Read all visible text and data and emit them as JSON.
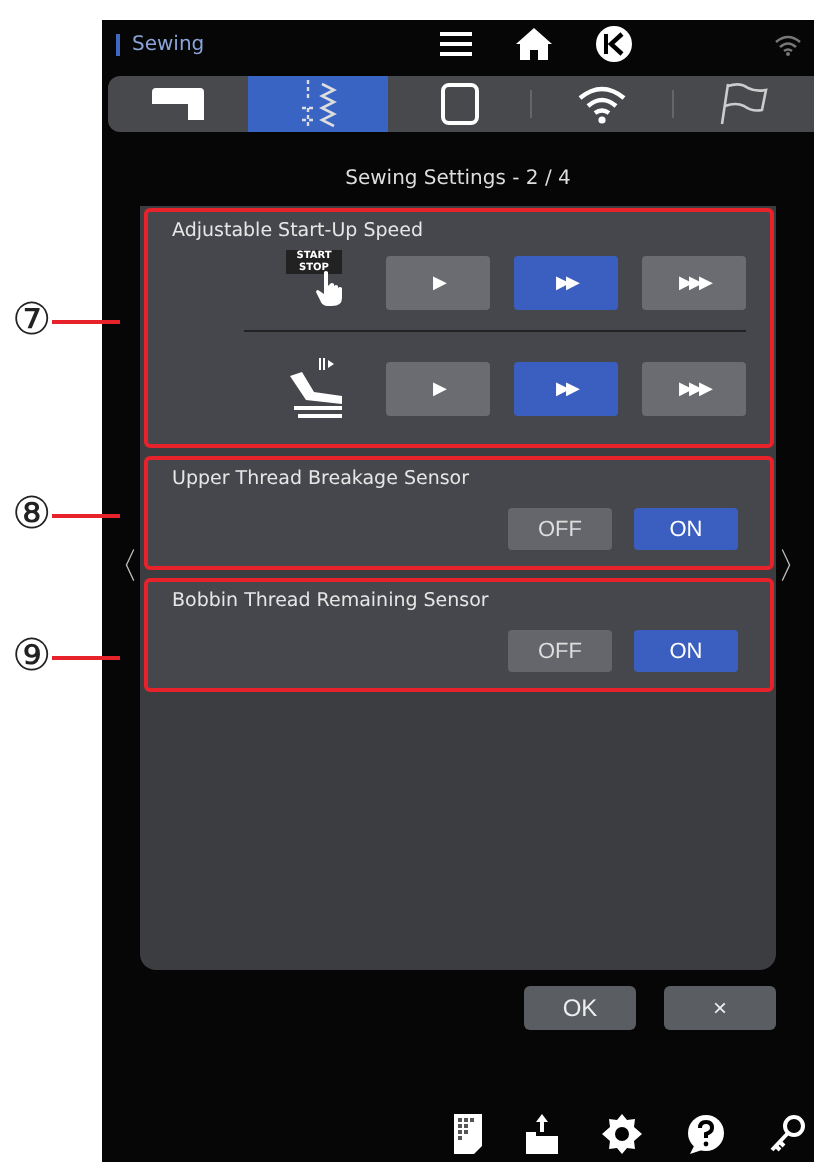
{
  "header": {
    "title": "Sewing"
  },
  "tabs": [
    {
      "kind": "machine",
      "selected": false
    },
    {
      "kind": "stitch",
      "selected": true
    },
    {
      "kind": "hoop",
      "selected": false
    },
    {
      "kind": "wifi",
      "selected": false
    },
    {
      "kind": "flag",
      "selected": false
    }
  ],
  "page_title": "Sewing Settings  -  2 / 4",
  "sections": [
    {
      "callout": "⑦",
      "title": "Adjustable Start-Up Speed",
      "kind": "speed",
      "rows": [
        {
          "kind": "start-stop",
          "icon_text": [
            "START",
            "STOP"
          ],
          "options": [
            {
              "label": "▶",
              "selected": false
            },
            {
              "label": "▶▶",
              "selected": true
            },
            {
              "label": "▶▶▶",
              "selected": false
            }
          ]
        },
        {
          "kind": "pedal",
          "options": [
            {
              "label": "▶",
              "selected": false
            },
            {
              "label": "▶▶",
              "selected": true
            },
            {
              "label": "▶▶▶",
              "selected": false
            }
          ]
        }
      ]
    },
    {
      "callout": "⑧",
      "title": "Upper Thread Breakage Sensor",
      "kind": "toggle",
      "options": [
        {
          "label": "OFF",
          "selected": false
        },
        {
          "label": "ON",
          "selected": true
        }
      ]
    },
    {
      "callout": "⑨",
      "title": "Bobbin Thread Remaining Sensor",
      "kind": "toggle",
      "options": [
        {
          "label": "OFF",
          "selected": false
        },
        {
          "label": "ON",
          "selected": true
        }
      ]
    }
  ],
  "nav": {
    "prev": "〈",
    "next": "〉"
  },
  "buttons": [
    {
      "label": "OK"
    },
    {
      "label": "×"
    }
  ]
}
